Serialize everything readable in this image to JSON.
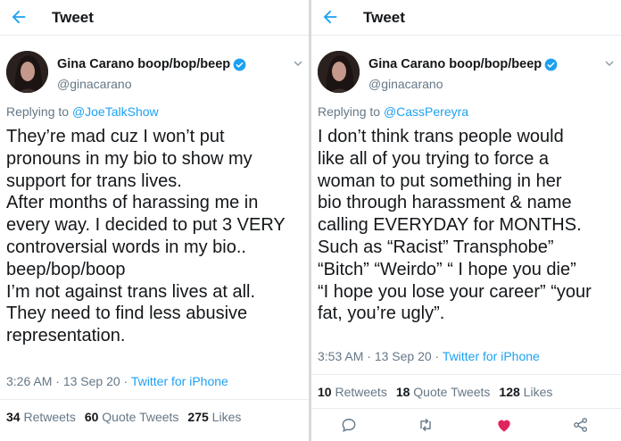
{
  "colors": {
    "accent": "#1da1f2",
    "like": "#e0245e",
    "muted": "#657786",
    "text": "#14171a"
  },
  "left": {
    "header": {
      "title": "Tweet"
    },
    "author": {
      "name": "Gina Carano boop/bop/beep",
      "handle": "@ginacarano"
    },
    "reply": {
      "prefix": "Replying to ",
      "to": "@JoeTalkShow"
    },
    "body": "They’re mad cuz I won’t put\npronouns in my bio to show my\nsupport for trans lives.\nAfter months of harassing me in\nevery way. I decided to put 3 VERY\ncontroversial words in my bio..\nbeep/bop/boop\nI’m not against trans lives at all.\nThey need to find less abusive\nrepresentation.",
    "meta": {
      "time": "3:26 AM",
      "sep1": " · ",
      "date": "13 Sep 20",
      "sep2": " · ",
      "source": "Twitter for iPhone"
    },
    "stats": {
      "retweets": "34",
      "retweets_label": " Retweets",
      "quotes": "60",
      "quotes_label": " Quote Tweets",
      "likes": "275",
      "likes_label": " Likes"
    }
  },
  "right": {
    "header": {
      "title": "Tweet"
    },
    "author": {
      "name": "Gina Carano boop/bop/beep",
      "handle": "@ginacarano"
    },
    "reply": {
      "prefix": "Replying to ",
      "to": "@CassPereyra"
    },
    "body": "I don’t think trans people would\nlike all of you trying to force a\nwoman to put something in her\nbio through harassment & name\ncalling EVERYDAY for MONTHS.\nSuch as “Racist” Transphobe”\n“Bitch” “Weirdo” “ I hope you die”\n“I hope you lose your career” “your\nfat, you’re ugly”.",
    "meta": {
      "time": "3:53 AM",
      "sep1": " · ",
      "date": "13 Sep 20",
      "sep2": " · ",
      "source": "Twitter for iPhone"
    },
    "stats": {
      "retweets": "10",
      "retweets_label": " Retweets",
      "quotes": "18",
      "quotes_label": " Quote Tweets",
      "likes": "128",
      "likes_label": " Likes"
    },
    "actions": [
      "reply-icon",
      "retweet-icon",
      "like-icon",
      "share-icon"
    ]
  }
}
